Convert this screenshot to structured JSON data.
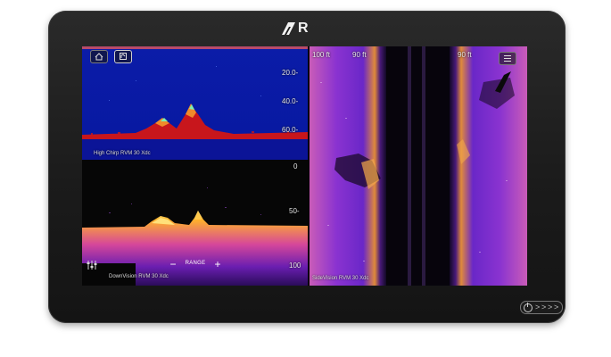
{
  "device": {
    "logo_text": "R",
    "power_button_icon": "power-icon",
    "nav_chevrons": [
      ">",
      ">",
      ">",
      ">"
    ]
  },
  "toolbar": {
    "home_icon": "home-icon",
    "app_icon": "sonar-app-icon",
    "menu_icon": "hamburger-menu-icon"
  },
  "high_chirp": {
    "label": "High Chirp RVM 30 Xdc",
    "depth_scale": [
      "20.0-",
      "40.0-",
      "60.0-"
    ]
  },
  "downvision": {
    "label": "DownVision RVM 30 Xdc",
    "depth_scale": [
      "0",
      "50-",
      "100"
    ],
    "range_label": "RANGE",
    "range_minus": "−",
    "range_plus": "+",
    "settings_icon": "sliders-icon"
  },
  "sidevision": {
    "label": "SideVision RVM 30 Xdc",
    "left_range": "100 ft",
    "center_range": "90 ft",
    "right_range": "90 ft"
  },
  "colors": {
    "highchirp_water": "#0a1bb8",
    "bottom_red": "#c2181a",
    "downvision_orange": "#ff9a1e",
    "sidevision_purple": "#7a2bd8",
    "selection_outline": "#d4621c"
  }
}
